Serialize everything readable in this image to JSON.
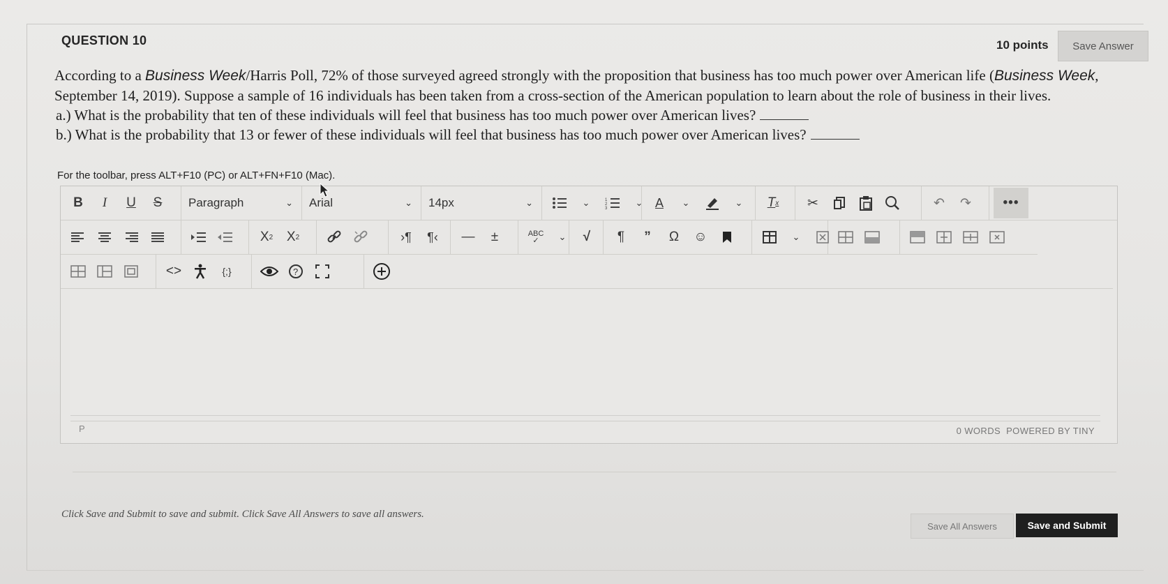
{
  "question": {
    "heading": "QUESTION 10",
    "points": "10 points",
    "save_answer_label": "Save Answer",
    "text_1": "According to a ",
    "text_bw": "Business Week",
    "text_2": "/Harris Poll, 72% of those surveyed agreed strongly with the proposition that business has too much power over American life (",
    "text_bw2": "Business Week",
    "text_3": ", September 14, 2019).  Suppose a sample of 16 individuals has been taken from a cross-section of the American population to learn about the role of business in their lives.",
    "part_a": "a.) What is the probability that ten of these individuals will feel that business has too much power over American lives?",
    "part_b": "b.) What is the probability that 13 or fewer of these individuals will feel that business has too much power over American lives?"
  },
  "editor": {
    "toolbar_hint": "For the toolbar, press ALT+F10 (PC) or ALT+FN+F10 (Mac).",
    "block_format": "Paragraph",
    "font_family": "Arial",
    "font_size": "14px",
    "more_label": "•••",
    "status_path": "P",
    "status_words": "0 WORDS",
    "status_powered": "POWERED BY TINY"
  },
  "footer": {
    "instructions": "Click Save and Submit to save and submit. Click Save All Answers to save all answers.",
    "save_all_label": "Save All Answers",
    "save_submit_label": "Save and Submit"
  }
}
